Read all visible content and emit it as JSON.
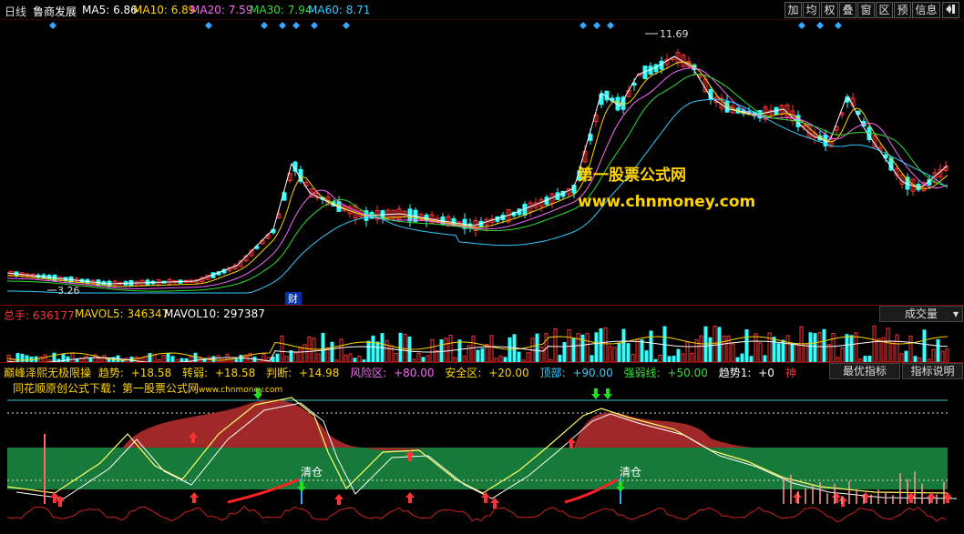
{
  "window": {
    "period_label": "日线",
    "stock_name": "鲁商发展"
  },
  "ma_legend": [
    {
      "label": "MA5:",
      "value": "6.86",
      "color": "#ffffff"
    },
    {
      "label": "MA10:",
      "value": "6.89",
      "color": "#ffd400"
    },
    {
      "label": "MA20:",
      "value": "7.59",
      "color": "#ff66ff"
    },
    {
      "label": "MA30:",
      "value": "7.94",
      "color": "#33dd33"
    },
    {
      "label": "MA60:",
      "value": "8.71",
      "color": "#33ccff"
    }
  ],
  "toolbar": {
    "buttons": [
      "加",
      "均",
      "权",
      "叠",
      "窗",
      "区",
      "预",
      "信息"
    ],
    "exit_icon": "exit-icon"
  },
  "price_chart": {
    "high_label": "11.69",
    "low_label": "3.26",
    "finance_tag": "财",
    "watermark_title": "第一股票公式网",
    "watermark_url": "www.chnmoney.com"
  },
  "volume_panel": {
    "total_label": "总手:",
    "total_value": "636177",
    "mavol5_label": "MAVOL5:",
    "mavol5_value": "346347",
    "mavol10_label": "MAVOL10:",
    "mavol10_value": "297387",
    "dropdown": "成交量"
  },
  "indicator_panel": {
    "name": "巅峰泽熙无极限操",
    "items": [
      {
        "label": "趋势:",
        "value": "+18.58",
        "color": "#ffd400"
      },
      {
        "label": "转弱:",
        "value": "+18.58",
        "color": "#ffd400"
      },
      {
        "label": "判断:",
        "value": "+14.98",
        "color": "#ffd400"
      },
      {
        "label": "风险区:",
        "value": "+80.00",
        "color": "#ff66ff"
      },
      {
        "label": "安全区:",
        "value": "+20.00",
        "color": "#ffd400"
      },
      {
        "label": "顶部:",
        "value": "+90.00",
        "color": "#33ccff"
      },
      {
        "label": "强弱线:",
        "value": "+50.00",
        "color": "#33dd33"
      },
      {
        "label": "趋势1:",
        "value": "+0",
        "color": "#ffffff"
      }
    ],
    "last_tag": "神",
    "best_indicator_button": "最优指标",
    "indicator_help_button": "指标说明",
    "credit_text": "同花顺原创公式下载：第一股票公式网",
    "credit_url": "www.chnmoney.com",
    "sell_label_1": "清仓",
    "sell_label_2": "清仓"
  },
  "colors": {
    "up": "#ff3333",
    "down": "#33ffff",
    "danger_fill": "#a02828",
    "safe_fill": "#187a3a"
  }
}
